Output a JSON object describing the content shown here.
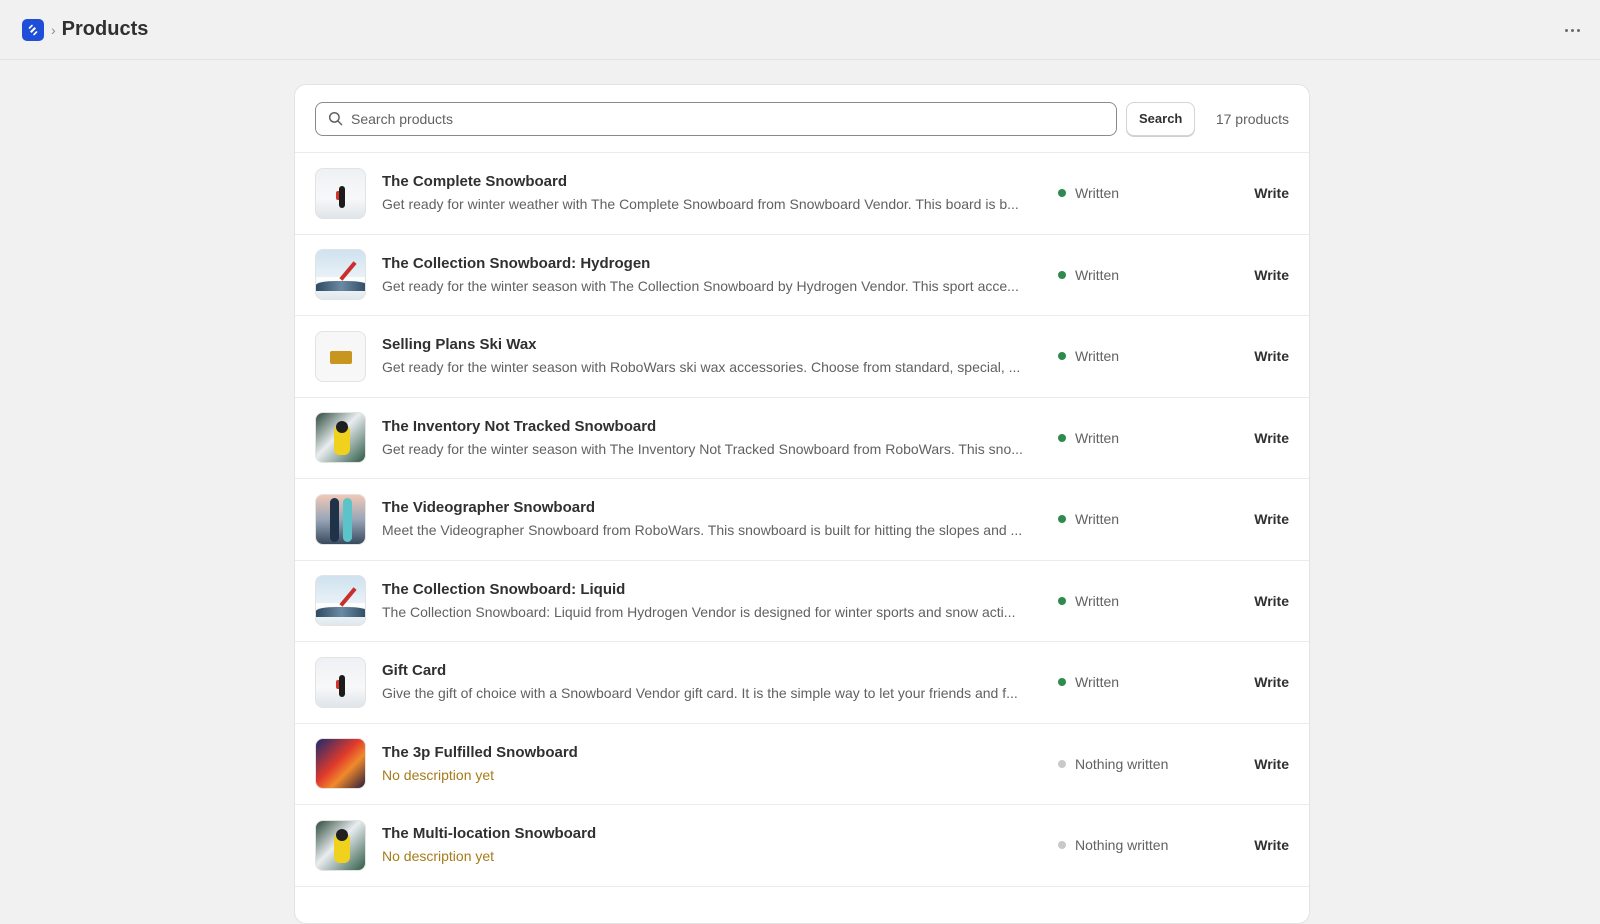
{
  "header": {
    "breadcrumb_separator": "›",
    "title": "Products",
    "more_icon": "more-horizontal-icon",
    "logo_icon": "app-logo-icon",
    "logo_color": "#1f4ed8"
  },
  "search": {
    "placeholder": "Search products",
    "value": "",
    "button_label": "Search",
    "count_label": "17 products"
  },
  "status_colors": {
    "written": "#2e8a4f",
    "nothing": "#c9c9c9"
  },
  "products": [
    {
      "name": "The Complete Snowboard",
      "description": "Get ready for winter weather with The Complete Snowboard from Snowboard Vendor. This board is b...",
      "status": "Written",
      "status_key": "written",
      "action": "Write",
      "thumb": "snow-person"
    },
    {
      "name": "The Collection Snowboard: Hydrogen",
      "description": "Get ready for the winter season with The Collection Snowboard by Hydrogen Vendor. This sport acce...",
      "status": "Written",
      "status_key": "written",
      "action": "Write",
      "thumb": "mountain"
    },
    {
      "name": "Selling Plans Ski Wax",
      "description": "Get ready for the winter season with RoboWars ski wax accessories. Choose from standard, special, ...",
      "status": "Written",
      "status_key": "written",
      "action": "Write",
      "thumb": "wax"
    },
    {
      "name": "The Inventory Not Tracked Snowboard",
      "description": "Get ready for the winter season with The Inventory Not Tracked Snowboard from RoboWars. This sno...",
      "status": "Written",
      "status_key": "written",
      "action": "Write",
      "thumb": "forest"
    },
    {
      "name": "The Videographer Snowboard",
      "description": "Meet the Videographer Snowboard from RoboWars. This snowboard is built for hitting the slopes and ...",
      "status": "Written",
      "status_key": "written",
      "action": "Write",
      "thumb": "boards"
    },
    {
      "name": "The Collection Snowboard: Liquid",
      "description": "The Collection Snowboard: Liquid from Hydrogen Vendor is designed for winter sports and snow acti...",
      "status": "Written",
      "status_key": "written",
      "action": "Write",
      "thumb": "mountain"
    },
    {
      "name": "Gift Card",
      "description": "Give the gift of choice with a Snowboard Vendor gift card. It is the simple way to let your friends and f...",
      "status": "Written",
      "status_key": "written",
      "action": "Write",
      "thumb": "snow-person"
    },
    {
      "name": "The 3p Fulfilled Snowboard",
      "description": "No description yet",
      "status": "Nothing written",
      "status_key": "nothing",
      "action": "Write",
      "thumb": "gradient"
    },
    {
      "name": "The Multi-location Snowboard",
      "description": "No description yet",
      "status": "Nothing written",
      "status_key": "nothing",
      "action": "Write",
      "thumb": "forest"
    }
  ]
}
